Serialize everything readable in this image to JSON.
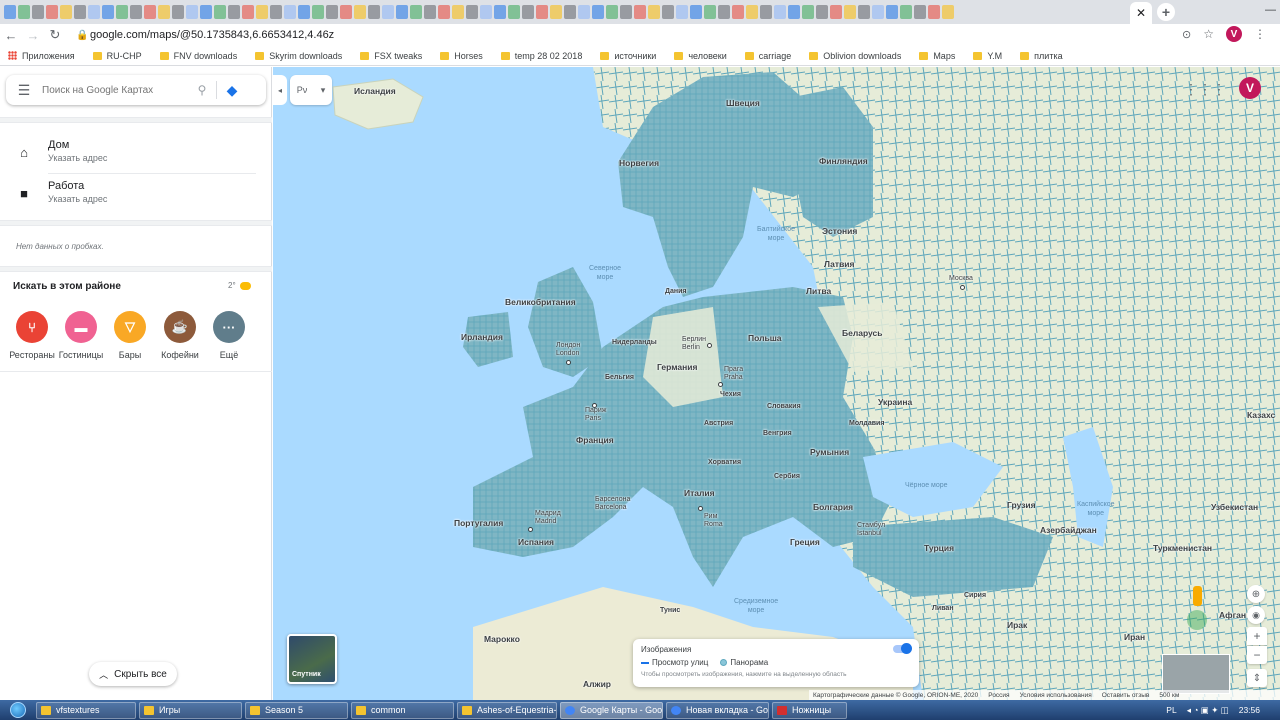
{
  "browser": {
    "url": "google.com/maps/@50.1735843,6.6653412,4.46z",
    "profile_initial": "V",
    "bookmarks": [
      {
        "label": "Приложения",
        "type": "apps"
      },
      {
        "label": "RU-CHP",
        "type": "folder"
      },
      {
        "label": "FNV downloads",
        "type": "folder"
      },
      {
        "label": "Skyrim downloads",
        "type": "folder"
      },
      {
        "label": "FSX tweaks",
        "type": "folder"
      },
      {
        "label": "Horses",
        "type": "folder"
      },
      {
        "label": "temp 28 02 2018",
        "type": "folder"
      },
      {
        "label": "источники",
        "type": "folder"
      },
      {
        "label": "человеки",
        "type": "folder"
      },
      {
        "label": "carriage",
        "type": "folder"
      },
      {
        "label": "Oblivion downloads",
        "type": "folder"
      },
      {
        "label": "Maps",
        "type": "folder"
      },
      {
        "label": "Y.M",
        "type": "folder"
      },
      {
        "label": "плитка",
        "type": "folder"
      }
    ]
  },
  "panel": {
    "search_placeholder": "Поиск на Google Картах",
    "home_title": "Дом",
    "home_sub": "Указать адрес",
    "work_title": "Работа",
    "work_sub": "Указать адрес",
    "traffic_note": "Нет данных о пробках.",
    "nearby_title": "Искать в этом районе",
    "temperature": "2°",
    "categories": [
      {
        "label": "Рестораны",
        "color": "#ea4335",
        "icon": "restaurant-icon"
      },
      {
        "label": "Гостиницы",
        "color": "#f06292",
        "icon": "hotel-icon"
      },
      {
        "label": "Бары",
        "color": "#f9a825",
        "icon": "bar-icon"
      },
      {
        "label": "Кофейни",
        "color": "#8d5a3b",
        "icon": "coffee-icon"
      },
      {
        "label": "Ещё",
        "color": "#607d8b",
        "icon": "more-icon"
      }
    ],
    "hide_all": "Скрыть все"
  },
  "map": {
    "lang_btn": "Рν",
    "labels": {
      "iceland": "Исландия",
      "sweden": "Швеция",
      "norway": "Норвегия",
      "finland": "Финляндия",
      "estonia": "Эстония",
      "latvia": "Латвия",
      "lithuania": "Литва",
      "denmark": "Дания",
      "uk": "Великобритания",
      "ireland": "Ирландия",
      "netherlands": "Нидерланды",
      "germany": "Германия",
      "poland": "Польша",
      "belarus": "Беларусь",
      "belgium": "Бельгия",
      "czechia": "Чехия",
      "ukraine": "Украина",
      "slovakia": "Словакия",
      "austria": "Австрия",
      "hungary": "Венгрия",
      "moldova": "Молдавия",
      "france": "Франция",
      "romania": "Румыния",
      "croatia": "Хорватия",
      "serbia": "Сербия",
      "italy": "Италия",
      "bulgaria": "Болгария",
      "portugal": "Португалия",
      "spain": "Испания",
      "greece": "Греция",
      "turkey": "Турция",
      "georgia": "Грузия",
      "azerbaijan": "Азербайджан",
      "uzbekistan": "Узбекистан",
      "turkmenistan": "Туркменистан",
      "kazakh": "Казахс",
      "morocco": "Марокко",
      "algeria": "Алжир",
      "tunisia": "Тунис",
      "syria": "Сирия",
      "lebanon": "Ливан",
      "iraq": "Ирак",
      "iran": "Иран",
      "afghan": "Афган"
    },
    "seas": {
      "north_sea": "Северное\nморе",
      "baltic": "Балтийское\nморе",
      "black_sea": "Чёрное море",
      "caspian": "Каспийское\nморе",
      "mediterranean": "Средиземное\nморе"
    },
    "cities": {
      "london": "Лондон\nLondon",
      "paris": "Париж\nParis",
      "berlin": "Берлин\nBerlin",
      "prague": "Прага\nPraha",
      "madrid": "Мадрид\nMadrid",
      "barcelona": "Барселона\nBarcelona",
      "rome": "Рим\nRoma",
      "istanbul": "Стамбул\nİstanbul",
      "moscow": "Москва"
    },
    "satellite_label": "Спутник",
    "layers": {
      "title": "Изображения",
      "street_view": "Просмотр улиц",
      "panorama": "Панорама",
      "hint": "Чтобы просмотреть изображения, нажмите на выделенную область"
    },
    "footer": [
      "Картографические данные © Google, ORION-ME, 2020",
      "Россия",
      "Условия использования",
      "Оставить отзыв",
      "500 км"
    ]
  },
  "taskbar": {
    "items": [
      "vfstextures",
      "Игры",
      "Season 5",
      "common",
      "Ashes-of-Equestria-...",
      "Google Карты - Goo...",
      "Новая вкладка - Go...",
      "Ножницы"
    ],
    "lang": "PL",
    "time": "23:56"
  }
}
